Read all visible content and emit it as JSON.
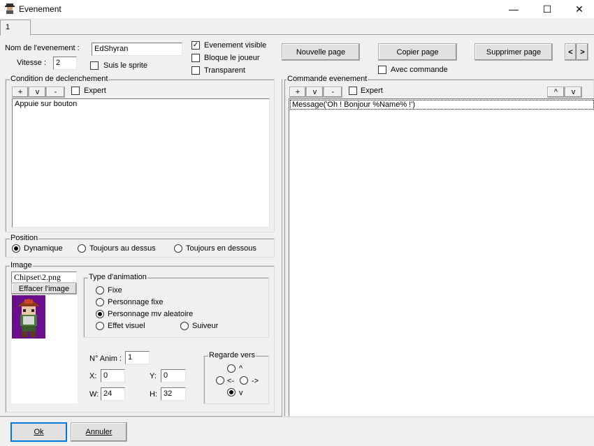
{
  "window": {
    "title": "Evenement",
    "minimize": "—",
    "maximize": "☐",
    "close": "✕"
  },
  "tabs": [
    "1"
  ],
  "event": {
    "name_label": "Nom de l'evenement :",
    "name_value": "EdShyran",
    "speed_label": "Vitesse :",
    "speed_value": "2",
    "follow_sprite_label": "Suis le sprite",
    "visible_label": "Evenement visible",
    "blocks_player_label": "Bloque le joueur",
    "transparent_label": "Transparent"
  },
  "page_buttons": {
    "new_page": "Nouvelle page",
    "copy_page": "Copier page",
    "delete_page": "Supprimer page",
    "prev": "<",
    "next": ">",
    "with_command_label": "Avec commande"
  },
  "trigger": {
    "title": "Condition de declenchement",
    "plus": "+",
    "v": "v",
    "minus": "-",
    "expert_label": "Expert",
    "items": [
      "Appuie sur bouton"
    ]
  },
  "position": {
    "title": "Position",
    "options": [
      "Dynamique",
      "Toujours au dessus",
      "Toujours en dessous"
    ],
    "selected": "Dynamique"
  },
  "image": {
    "title": "Image",
    "file": "Chipset\\2.png",
    "clear_button": "Effacer l'image"
  },
  "animation": {
    "title": "Type d'animation",
    "options": [
      "Fixe",
      "Personnage fixe",
      "Personnage mv aleatoire",
      "Effet visuel",
      "Suiveur"
    ],
    "selected": "Personnage mv aleatoire",
    "anim_label": "N° Anim :",
    "anim_value": "1",
    "x_label": "X:",
    "x_value": "0",
    "y_label": "Y:",
    "y_value": "0",
    "w_label": "W:",
    "w_value": "24",
    "h_label": "H:",
    "h_value": "32"
  },
  "facing": {
    "title": "Regarde vers",
    "up": "^",
    "left": "<-",
    "right": "->",
    "down": "v",
    "selected": "v"
  },
  "commands": {
    "title": "Commande evenement",
    "plus": "+",
    "v": "v",
    "minus": "-",
    "expert_label": "Expert",
    "up": "^",
    "down": "v",
    "items": [
      "Message('Oh ! Bonjour %Name% !')"
    ]
  },
  "footer": {
    "ok": "Ok",
    "cancel": "Annuler"
  },
  "colors": {
    "sprite_bg": "#6a0e8e",
    "selection_border": "#000000"
  }
}
